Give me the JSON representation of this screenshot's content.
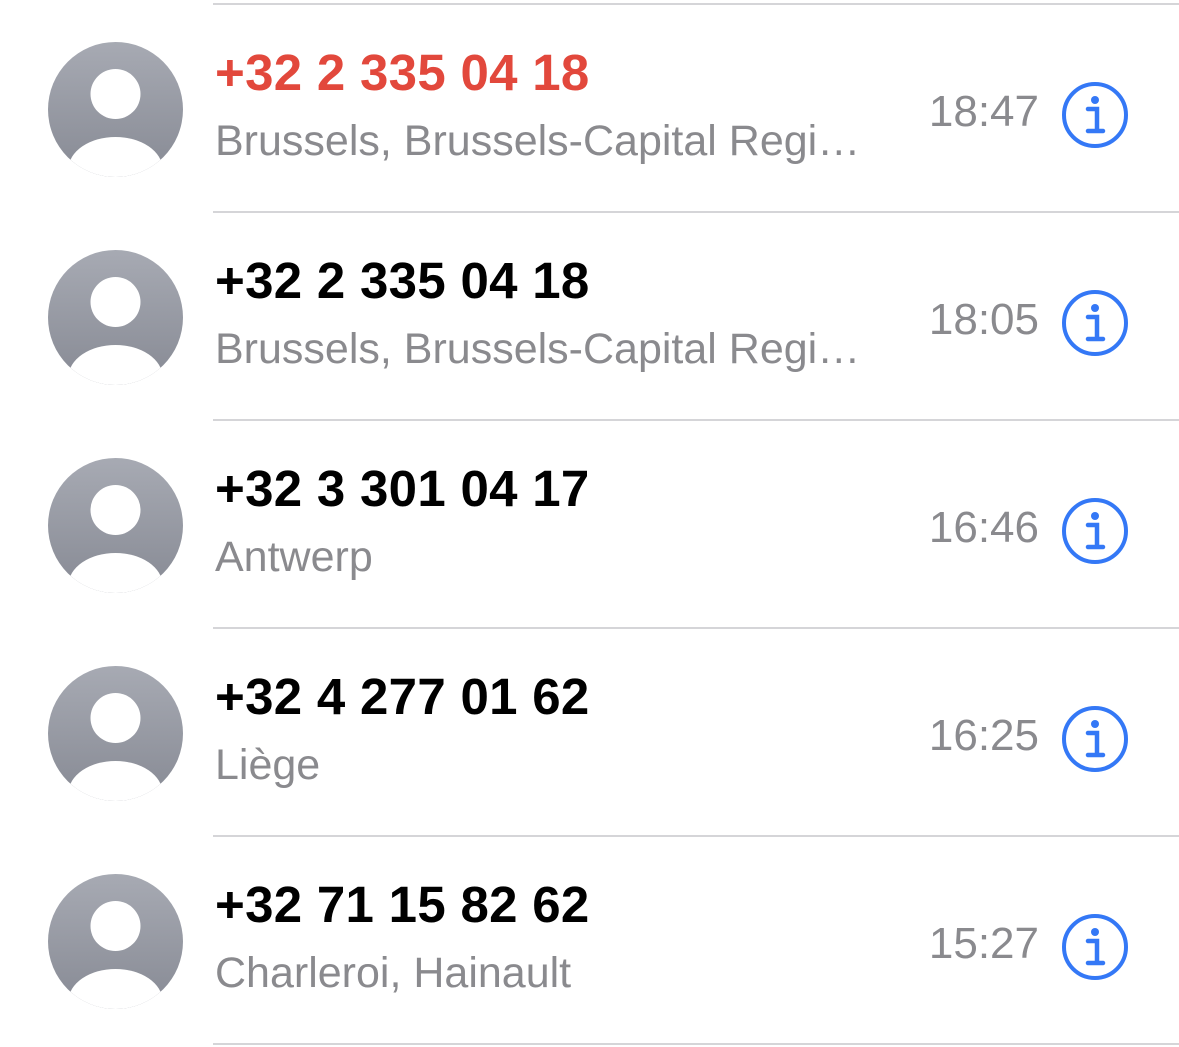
{
  "colors": {
    "missed": "#e2483c",
    "primary": "#000000",
    "secondary": "#8a8a8e",
    "accent": "#3478f6",
    "avatar_bg": "#a1a4ad",
    "divider": "#d5d5d8"
  },
  "calls": [
    {
      "number": "+32 2 335 04 18",
      "location": "Brussels, Brussels-Capital Regi…",
      "time": "18:47",
      "missed": true,
      "avatar_icon": "person-silhouette-icon",
      "info_icon": "info-icon"
    },
    {
      "number": "+32 2 335 04 18",
      "location": "Brussels, Brussels-Capital Regi…",
      "time": "18:05",
      "missed": false,
      "avatar_icon": "person-silhouette-icon",
      "info_icon": "info-icon"
    },
    {
      "number": "+32 3 301 04 17",
      "location": "Antwerp",
      "time": "16:46",
      "missed": false,
      "avatar_icon": "person-silhouette-icon",
      "info_icon": "info-icon"
    },
    {
      "number": "+32 4 277 01 62",
      "location": "Liège",
      "time": "16:25",
      "missed": false,
      "avatar_icon": "person-silhouette-icon",
      "info_icon": "info-icon"
    },
    {
      "number": "+32 71 15 82 62",
      "location": "Charleroi, Hainault",
      "time": "15:27",
      "missed": false,
      "avatar_icon": "person-silhouette-icon",
      "info_icon": "info-icon"
    }
  ]
}
